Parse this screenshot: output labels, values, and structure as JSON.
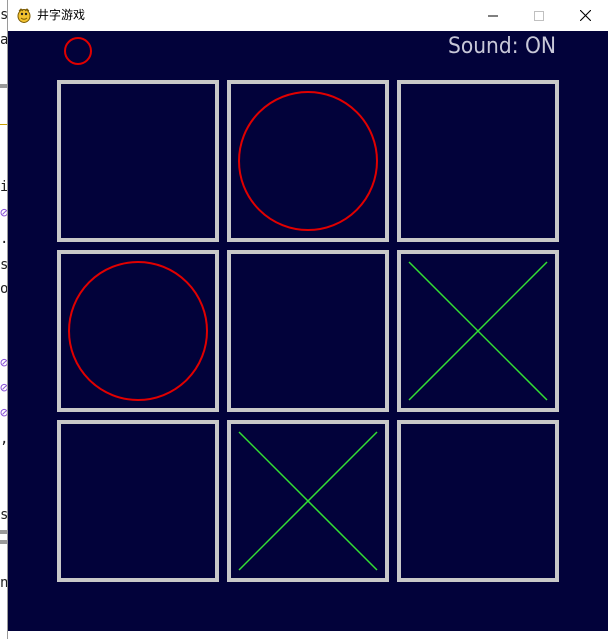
{
  "window": {
    "title": "井字游戏",
    "app_icon": "pygame-snake-icon",
    "controls": [
      "minimize-icon",
      "maximize-icon",
      "close-icon"
    ]
  },
  "game": {
    "sound_label": "Sound: ON",
    "current_turn_marker": "O",
    "board": [
      [
        "",
        "O",
        ""
      ],
      [
        "O",
        "",
        "X"
      ],
      [
        "",
        "X",
        ""
      ]
    ]
  },
  "colors": {
    "background": "#02023a",
    "grid": "#c8c8c8",
    "o_mark": "#e00000",
    "x_mark": "#33e033",
    "sound_text": "#c8c8d8"
  },
  "background_editor": {
    "visible_chars": [
      "s",
      "a",
      "i",
      "⊘",
      ".",
      "s",
      "o",
      "⊘",
      "⊘",
      "⊘",
      ",",
      "s",
      "n"
    ]
  }
}
